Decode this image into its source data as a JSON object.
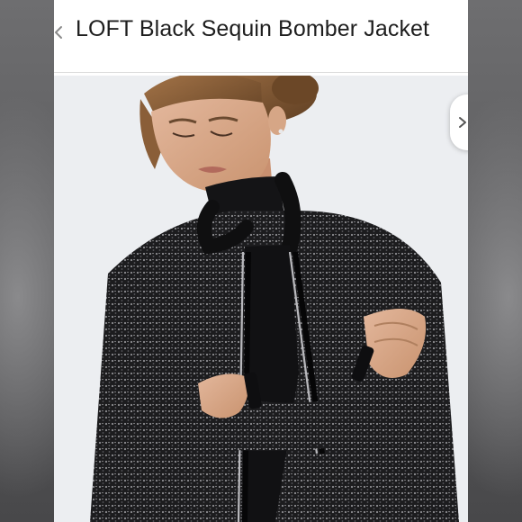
{
  "listing": {
    "title": "LOFT Black Sequin Bomber Jacket"
  },
  "icons": {
    "back": "chevron-left-icon",
    "next": "chevron-right-icon"
  },
  "colors": {
    "page_background": "#5a5a5c",
    "header_background": "#ffffff",
    "title_text": "#1e1e1e",
    "photo_background": "#ecedf0",
    "jacket": "#1b1b1d"
  }
}
